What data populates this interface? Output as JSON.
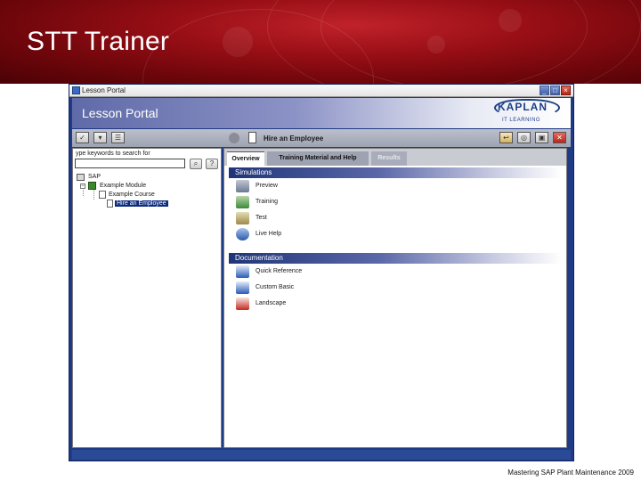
{
  "slide": {
    "title": "STT Trainer",
    "footer": "Mastering SAP Plant Maintenance 2009"
  },
  "window": {
    "title": "Lesson Portal",
    "controls": {
      "minimize": "_",
      "maximize": "□",
      "close": "×"
    }
  },
  "header": {
    "title": "Lesson Portal",
    "logo_word": "KAPLAN",
    "logo_sub": "IT LEARNING"
  },
  "toolbar": {
    "left_icons": [
      "check-icon",
      "refresh-icon",
      "list-icon"
    ],
    "lesson_name": "Hire an Employee",
    "right_icons": [
      "exit-icon",
      "globe-icon",
      "save-icon",
      "close-icon"
    ]
  },
  "search": {
    "label": "ype keywords to search for",
    "value": "",
    "go_glyph": "⌕",
    "help_glyph": "?"
  },
  "tree": {
    "root": "SAP",
    "module": "Example Module",
    "course": "Example Course",
    "lesson": "Hire an Employee"
  },
  "tabs": [
    {
      "label": "Overview",
      "state": "active"
    },
    {
      "label": "Training Material and Help",
      "state": "normal"
    },
    {
      "label": "Results",
      "state": "disabled"
    }
  ],
  "simulations": {
    "header": "Simulations",
    "items": [
      {
        "label": "Preview",
        "icon": "preview-icon",
        "color": "#6a7a94"
      },
      {
        "label": "Training",
        "icon": "training-icon",
        "color": "#3c8a3c"
      },
      {
        "label": "Test",
        "icon": "test-icon",
        "color": "#9c8a4a"
      },
      {
        "label": "Live Help",
        "icon": "live-help-icon",
        "color": "#2a5aa8"
      }
    ]
  },
  "documentation": {
    "header": "Documentation",
    "items": [
      {
        "label": "Quick Reference",
        "icon": "word-doc-icon",
        "color": "#2a5ab8"
      },
      {
        "label": "Custom Basic",
        "icon": "word-doc-icon",
        "color": "#2a5ab8"
      },
      {
        "label": "Landscape",
        "icon": "pdf-icon",
        "color": "#c22a1e"
      }
    ]
  },
  "colors": {
    "banner": "#9a0f16",
    "window_frame": "#1f3b86",
    "section_header": "#1f3578",
    "selection": "#0a2a80"
  }
}
